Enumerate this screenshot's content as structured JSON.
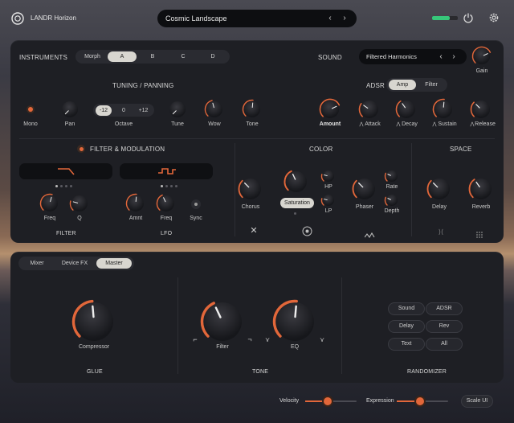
{
  "app": {
    "name": "LANDR Horizon"
  },
  "preset": {
    "name": "Cosmic Landscape"
  },
  "colors": {
    "accent": "#e2673a",
    "level": "#37c77a",
    "panel": "#1e1f24"
  },
  "instruments": {
    "title": "INSTRUMENTS",
    "tabs": [
      "Morph",
      "A",
      "B",
      "C",
      "D"
    ],
    "selected": "A",
    "sound_label": "SOUND",
    "sound_value": "Filtered Harmonics",
    "gain_label": "Gain"
  },
  "tuning": {
    "title": "TUNING / PANNING",
    "mono_label": "Mono",
    "pan_label": "Pan",
    "octave_label": "Octave",
    "octave_options": [
      "-12",
      "0",
      "+12"
    ],
    "tune_label": "Tune",
    "wow_label": "Wow",
    "tone_label": "Tone"
  },
  "adsr": {
    "title": "ADSR",
    "tabs": [
      "Amp",
      "Filter"
    ],
    "amount_label": "Amount",
    "attack_label": "Attack",
    "decay_label": "Decay",
    "sustain_label": "Sustain",
    "release_label": "Release"
  },
  "filter_mod": {
    "title": "FILTER & MODULATION",
    "filter_label": "FILTER",
    "lfo_label": "LFO",
    "freq_label": "Freq",
    "q_label": "Q",
    "amnt_label": "Amnt",
    "lfo_freq_label": "Freq",
    "sync_label": "Sync"
  },
  "color": {
    "title": "COLOR",
    "chorus_label": "Chorus",
    "saturation_label": "Saturation",
    "hp_label": "HP",
    "lp_label": "LP",
    "phaser_label": "Phaser",
    "rate_label": "Rate",
    "depth_label": "Depth"
  },
  "space": {
    "title": "SPACE",
    "delay_label": "Delay",
    "reverb_label": "Reverb"
  },
  "bottom": {
    "tabs": [
      "Mixer",
      "Device FX",
      "Master"
    ],
    "selected": "Master",
    "glue_title": "GLUE",
    "compressor_label": "Compressor",
    "tone_title": "TONE",
    "filter_label": "Filter",
    "eq_label": "EQ",
    "randomizer_title": "RANDOMIZER",
    "randomizer_buttons": [
      "Sound",
      "ADSR",
      "Delay",
      "Rev",
      "Text",
      "All"
    ]
  },
  "footer": {
    "velocity_label": "Velocity",
    "expression_label": "Expression",
    "scale_label": "Scale UI",
    "velocity_level": 0.44,
    "expression_level": 0.45
  }
}
